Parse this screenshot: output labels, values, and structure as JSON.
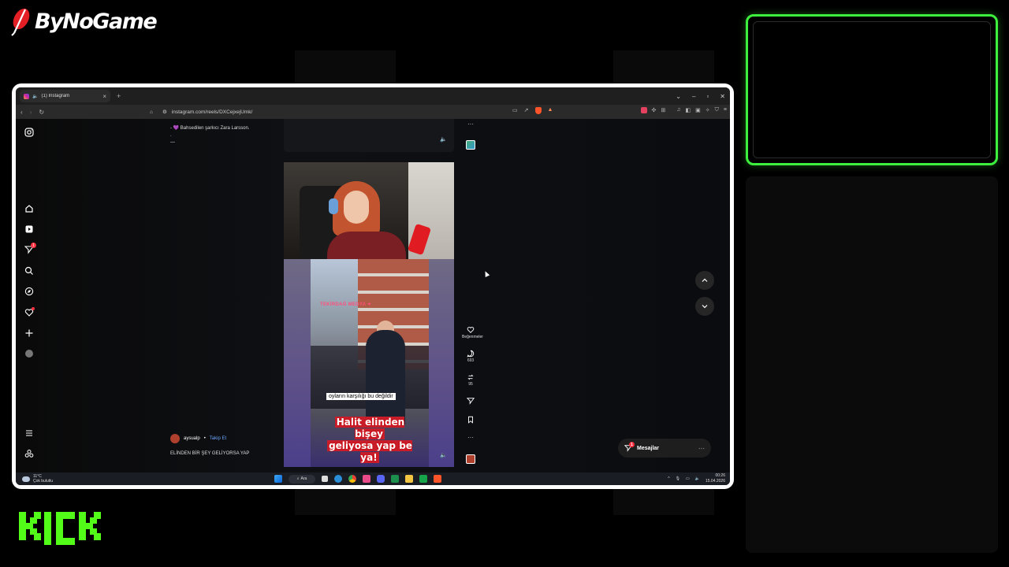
{
  "brand": {
    "name": "ByNoGame"
  },
  "kick_logo": {
    "text": "KICK",
    "color": "#53fc18"
  },
  "colors": {
    "webcam_border": "#3df03d",
    "badge": "#ff3040",
    "follow_link": "#6fa8ff"
  },
  "browser": {
    "tab_title": "(1) Instagram",
    "url": "instagram.com/reels/DXCejxejUmk/"
  },
  "instagram": {
    "prev_caption_line1": "- 💜 Bahsedilen şarkıcı Zara Larsson.",
    "prev_caption_line2": ".",
    "prev_caption_line3": "—",
    "notification_count": "1",
    "video": {
      "watermark": "TEKİRDAĞ MEDYA ✦",
      "subtitle": "oyların karşılığı bu değildir",
      "caption_line1": "Halit elinden bişey",
      "caption_line2": "geliyosa yap be ya!"
    },
    "actions": {
      "likes_label": "Beğenmeler",
      "comments_count": "693",
      "reposts_count": "95"
    },
    "post": {
      "author": "aysualp",
      "separator": "•",
      "follow_label": "Takip Et",
      "caption": "ELİNDEN BİR ŞEY GELİYORSA YAP"
    },
    "messages_label": "Mesajlar",
    "messages_badge": "1"
  },
  "taskbar": {
    "temperature": "11°C",
    "weather": "Çok bulutlu",
    "search_label": "Ara",
    "time": "00:26",
    "date": "15.04.2026"
  }
}
